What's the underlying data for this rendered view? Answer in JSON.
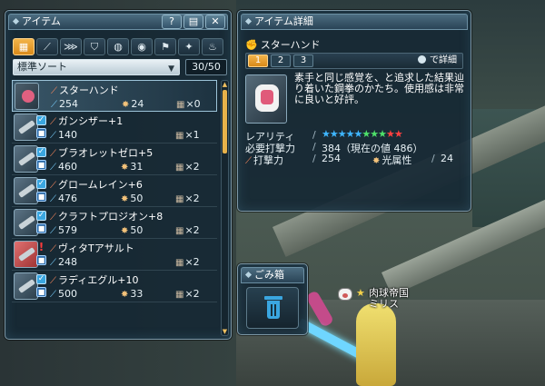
{
  "item_window": {
    "title": "アイテム",
    "buttons": {
      "help": "?",
      "settings": "▤",
      "close": "✕"
    },
    "category_tabs": [
      {
        "icon": "grid-icon",
        "glyph": "▦",
        "active": true
      },
      {
        "icon": "sword-icon",
        "glyph": "⟋",
        "active": false
      },
      {
        "icon": "claw-icon",
        "glyph": "⋙",
        "active": false
      },
      {
        "icon": "shirt-icon",
        "glyph": "⛉",
        "active": false
      },
      {
        "icon": "capsule-icon",
        "glyph": "◍",
        "active": false
      },
      {
        "icon": "disc-icon",
        "glyph": "◉",
        "active": false
      },
      {
        "icon": "flag-icon",
        "glyph": "⚑",
        "active": false
      },
      {
        "icon": "cross-icon",
        "glyph": "✦",
        "active": false
      },
      {
        "icon": "bag-icon",
        "glyph": "♨",
        "active": false
      }
    ],
    "sort_label": "標準ソート",
    "count": "30/50",
    "items": [
      {
        "name": "スターハンド",
        "atk": "254",
        "elem": "24",
        "qty": "×0",
        "thumb": "hand",
        "check": false,
        "lock": false,
        "warn": false,
        "selected": true
      },
      {
        "name": "ガンシザー+1",
        "atk": "140",
        "elem": "",
        "qty": "×1",
        "thumb": "gun",
        "check": true,
        "lock": true,
        "warn": false,
        "selected": false
      },
      {
        "name": "ブラオレットゼロ+5",
        "atk": "460",
        "elem": "31",
        "qty": "×2",
        "thumb": "gun",
        "check": true,
        "lock": true,
        "warn": false,
        "selected": false
      },
      {
        "name": "グロームレイン+6",
        "atk": "476",
        "elem": "50",
        "qty": "×2",
        "thumb": "gun",
        "check": true,
        "lock": true,
        "warn": false,
        "selected": false
      },
      {
        "name": "クラフトプロジオン+8",
        "atk": "579",
        "elem": "50",
        "qty": "×2",
        "thumb": "gun",
        "check": true,
        "lock": true,
        "warn": false,
        "selected": false
      },
      {
        "name": "ヴィタTアサルト",
        "atk": "248",
        "elem": "",
        "qty": "×2",
        "thumb": "warn",
        "check": false,
        "lock": true,
        "warn": true,
        "selected": false
      },
      {
        "name": "ラディエグル+10",
        "atk": "500",
        "elem": "33",
        "qty": "×2",
        "thumb": "gun",
        "check": true,
        "lock": true,
        "warn": false,
        "selected": false
      }
    ]
  },
  "detail_window": {
    "title": "アイテム詳細",
    "item_name": "スターハンド",
    "pages": [
      "1",
      "2",
      "3"
    ],
    "active_page": "1",
    "detail_link": "で詳細",
    "description": "素手と同じ感覚を、と追求した結果辿り着いた鋼拳のかたち。使用感は非常に良いと好評。",
    "rarity_label": "レアリティ",
    "rarity_stars": {
      "blue": 5,
      "green": 3,
      "red": 2
    },
    "req_label": "必要打撃力",
    "req_value": "384（現在の値 486）",
    "atk_label": "打撃力",
    "atk_value": "254",
    "elem_label": "光属性",
    "elem_value": "24"
  },
  "trash_window": {
    "title": "ごみ箱"
  },
  "player": {
    "guild": "肉球帝国",
    "name": "ミリス"
  }
}
